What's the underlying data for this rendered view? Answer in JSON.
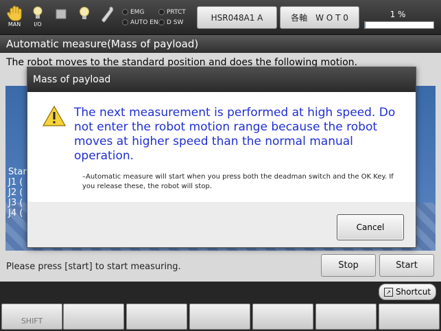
{
  "topbar": {
    "mode_label": "MAN",
    "io_label": "I/O",
    "lamps": {
      "emg": "EMG",
      "prtct": "PRTCT",
      "auto_en": "AUTO EN",
      "dsw": "D SW"
    },
    "robot_button": "HSR048A1 A",
    "axis_button": "各軸　W O T 0",
    "progress_label": "1 %",
    "progress_value": 1
  },
  "page": {
    "title": "Automatic measure(Mass of payload)",
    "description": "The robot moves to the standard position and does the following motion.",
    "viewport_lines": [
      "Star",
      "J1 (",
      "J2 (",
      "J3 (",
      "J4 ("
    ],
    "status_text": "Please press [start] to start measuring.",
    "stop_button": "Stop",
    "start_button": "Start"
  },
  "dialog": {
    "title": "Mass of payload",
    "message": "The next measurement is performed at high speed. Do not enter the robot motion range because the robot moves at higher speed than the normal manual operation.",
    "note": "–Automatic measure will start when you press both the deadman switch and the OK Key. If you release these, the robot will stop.",
    "cancel_button": "Cancel"
  },
  "bottom": {
    "shortcut_button": "Shortcut",
    "fkeys": [
      "SHIFT",
      "",
      "",
      "",
      "",
      "",
      ""
    ]
  },
  "colors": {
    "message_blue": "#1f2fd0",
    "title_bar": "#3a3a3a",
    "progress_fill": "#4a90d9"
  }
}
